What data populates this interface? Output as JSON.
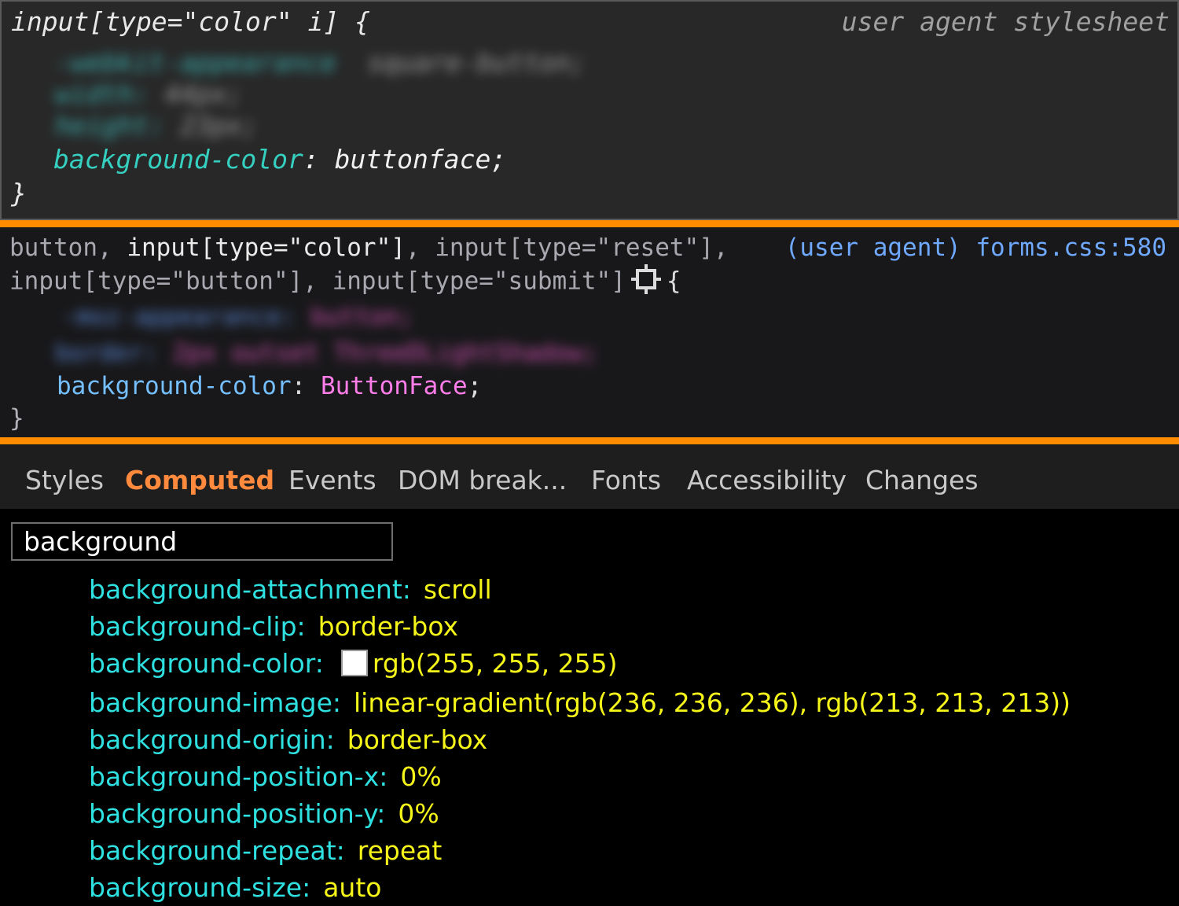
{
  "panel_top": {
    "selector": "input[type=\"color\" i] {",
    "source": "user agent stylesheet",
    "blurred": [
      {
        "prop": "-webkit-appearance",
        "value": "square-button;"
      },
      {
        "prop": "width:",
        "value": "44px;"
      },
      {
        "prop": "height:",
        "value": "23px;"
      }
    ],
    "declaration": {
      "prop": "background-color",
      "colon": ":",
      "value": "buttonface;"
    },
    "close": "}"
  },
  "panel_mid": {
    "selector_line1": {
      "a": "button, ",
      "b": "input[type=\"color\"]",
      "c": ", input[type=\"reset\"],"
    },
    "selector_line2": "input[type=\"button\"], input[type=\"submit\"]",
    "open_brace": "{",
    "source": "(user agent) forms.css:580",
    "blurred": [
      {
        "prop": "-moz-appearance:",
        "value": "button;"
      },
      {
        "prop": "border:",
        "value": "2px outset ThreeDLightShadow;"
      }
    ],
    "declaration": {
      "prop": "background-color",
      "colon": ":",
      "value": "ButtonFace",
      "semi": ";"
    },
    "close": "}"
  },
  "tabs": [
    {
      "label": "Styles",
      "active": false
    },
    {
      "label": "Computed",
      "active": true
    },
    {
      "label": "Events",
      "active": false
    },
    {
      "label": "DOM break...",
      "active": false
    },
    {
      "label": "Fonts",
      "active": false
    },
    {
      "label": "Accessibility",
      "active": false
    },
    {
      "label": "Changes",
      "active": false
    }
  ],
  "filter": {
    "value": "background"
  },
  "computed_properties": [
    {
      "name": "background-attachment",
      "value": "scroll"
    },
    {
      "name": "background-clip",
      "value": "border-box"
    },
    {
      "name": "background-color",
      "value": "rgb(255, 255, 255)",
      "swatch": "#ffffff"
    },
    {
      "name": "background-image",
      "value": "linear-gradient(rgb(236, 236, 236), rgb(213, 213, 213))"
    },
    {
      "name": "background-origin",
      "value": "border-box"
    },
    {
      "name": "background-position-x",
      "value": "0%"
    },
    {
      "name": "background-position-y",
      "value": "0%"
    },
    {
      "name": "background-repeat",
      "value": "repeat"
    },
    {
      "name": "background-size",
      "value": "auto"
    }
  ],
  "colors": {
    "accent": "#ff8c00",
    "computed_name": "#2fe0e0",
    "computed_value": "#f5f51a"
  }
}
